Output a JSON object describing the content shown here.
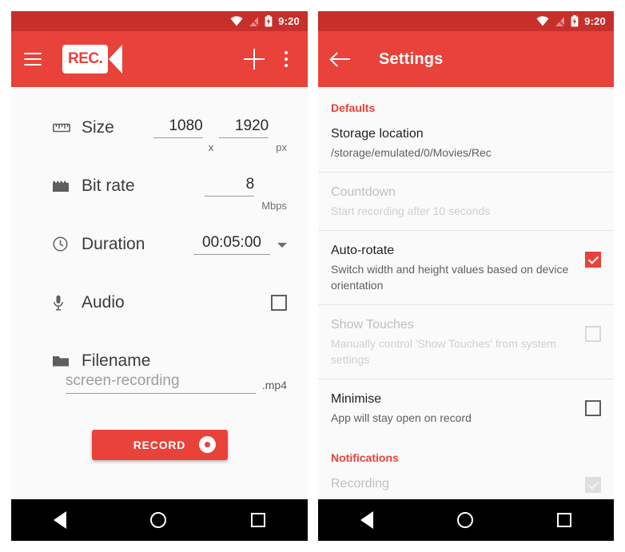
{
  "colors": {
    "brand_red": "#e8423a",
    "status_bar_red": "#c62f2a",
    "page_bg": "#fafafa",
    "nav_bar": "#000000"
  },
  "status_bar": {
    "time": "9:20",
    "icons": [
      "wifi-icon",
      "no-sim-icon",
      "battery-charging-icon"
    ]
  },
  "left_screen": {
    "toolbar": {
      "menu_icon": "hamburger-menu-icon",
      "logo_text": "REC.",
      "add_icon": "plus-icon",
      "overflow_icon": "more-vertical-icon"
    },
    "form": {
      "size": {
        "icon": "ruler-icon",
        "label": "Size",
        "width_value": "1080",
        "separator": "x",
        "height_value": "1920",
        "unit": "px"
      },
      "bitrate": {
        "icon": "clapperboard-icon",
        "label": "Bit rate",
        "value": "8",
        "unit": "Mbps"
      },
      "duration": {
        "icon": "clock-icon",
        "label": "Duration",
        "value": "00:05:00",
        "dropdown_icon": "caret-down-icon"
      },
      "audio": {
        "icon": "microphone-icon",
        "label": "Audio",
        "checked": false
      },
      "filename": {
        "icon": "folder-icon",
        "label": "Filename",
        "placeholder": "screen-recording",
        "value": "",
        "extension": ".mp4"
      }
    },
    "record_button": {
      "label": "RECORD",
      "icon": "record-dot-icon"
    }
  },
  "right_screen": {
    "toolbar": {
      "back_icon": "back-arrow-icon",
      "title": "Settings"
    },
    "sections": [
      {
        "heading": "Defaults",
        "items": [
          {
            "title": "Storage location",
            "subtitle": "/storage/emulated/0/Movies/Rec",
            "control": "none",
            "disabled": false
          },
          {
            "title": "Countdown",
            "subtitle": "Start recording after 10 seconds",
            "control": "none",
            "disabled": true
          },
          {
            "title": "Auto-rotate",
            "subtitle": "Switch width and height values based on device orientation",
            "control": "checkbox",
            "checked": true,
            "disabled": false
          },
          {
            "title": "Show Touches",
            "subtitle": "Manually control 'Show Touches' from system settings",
            "control": "checkbox",
            "checked": false,
            "disabled": true
          },
          {
            "title": "Minimise",
            "subtitle": "App will stay open on record",
            "control": "checkbox",
            "checked": false,
            "disabled": false
          }
        ]
      },
      {
        "heading": "Notifications",
        "items": [
          {
            "title": "Recording",
            "subtitle": "",
            "control": "checkbox",
            "checked": true,
            "disabled": true
          }
        ]
      }
    ]
  },
  "nav_bar": {
    "back_icon": "nav-back-triangle-icon",
    "home_icon": "nav-home-circle-icon",
    "recents_icon": "nav-recents-square-icon"
  }
}
